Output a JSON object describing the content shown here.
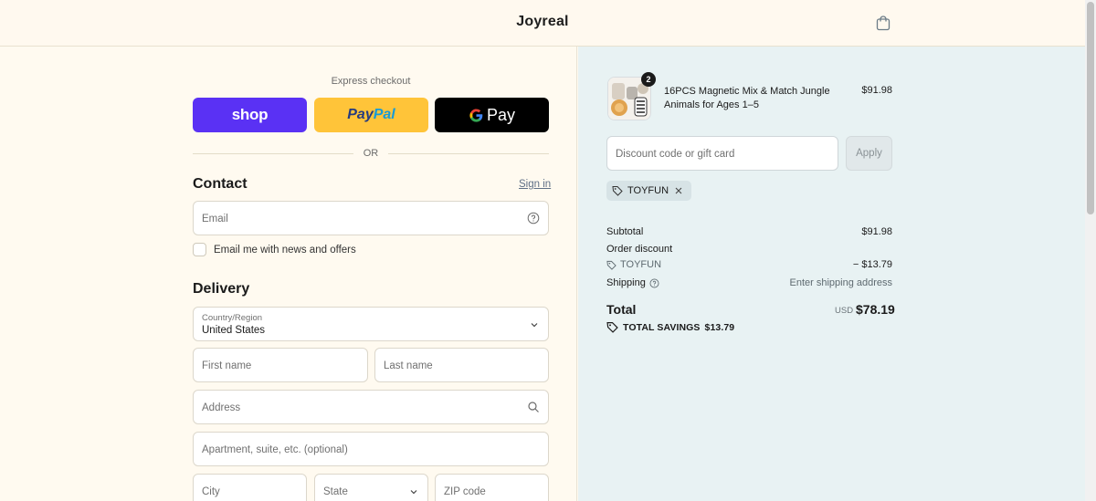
{
  "header": {
    "brand": "Joyreal",
    "cart_icon": "shopping-bag-icon"
  },
  "express": {
    "label": "Express checkout",
    "shop_label": "shop",
    "paypal_label_1": "Pay",
    "paypal_label_2": "Pal",
    "gpay_label": "Pay",
    "gpay_g": "G",
    "or_label": "OR"
  },
  "contact": {
    "title": "Contact",
    "sign_in": "Sign in",
    "email_placeholder": "Email",
    "newsletter_label": "Email me with news and offers"
  },
  "delivery": {
    "title": "Delivery",
    "country_label": "Country/Region",
    "country_value": "United States",
    "first_name_placeholder": "First name",
    "last_name_placeholder": "Last name",
    "address_placeholder": "Address",
    "apartment_placeholder": "Apartment, suite, etc. (optional)",
    "city_placeholder": "City",
    "state_placeholder": "State",
    "zip_placeholder": "ZIP code"
  },
  "order": {
    "product_name": "16PCS Magnetic Mix & Match Jungle Animals for Ages 1–5",
    "product_price": "$91.98",
    "quantity": "2",
    "discount_placeholder": "Discount code or gift card",
    "apply_label": "Apply",
    "applied_code": "TOYFUN",
    "subtotal_label": "Subtotal",
    "subtotal_value": "$91.98",
    "order_discount_label": "Order discount",
    "discount_code_label": "TOYFUN",
    "discount_value": "− $13.79",
    "shipping_label": "Shipping",
    "shipping_value": "Enter shipping address",
    "total_label": "Total",
    "total_currency": "USD",
    "total_value": "$78.19",
    "savings_label": "TOTAL SAVINGS",
    "savings_value": "$13.79"
  },
  "colors": {
    "shop_purple": "#5a31f4",
    "paypal_yellow": "#ffc439",
    "gpay_black": "#000000",
    "summary_bg": "#e8f2f3",
    "page_bg": "#fffaf0"
  }
}
